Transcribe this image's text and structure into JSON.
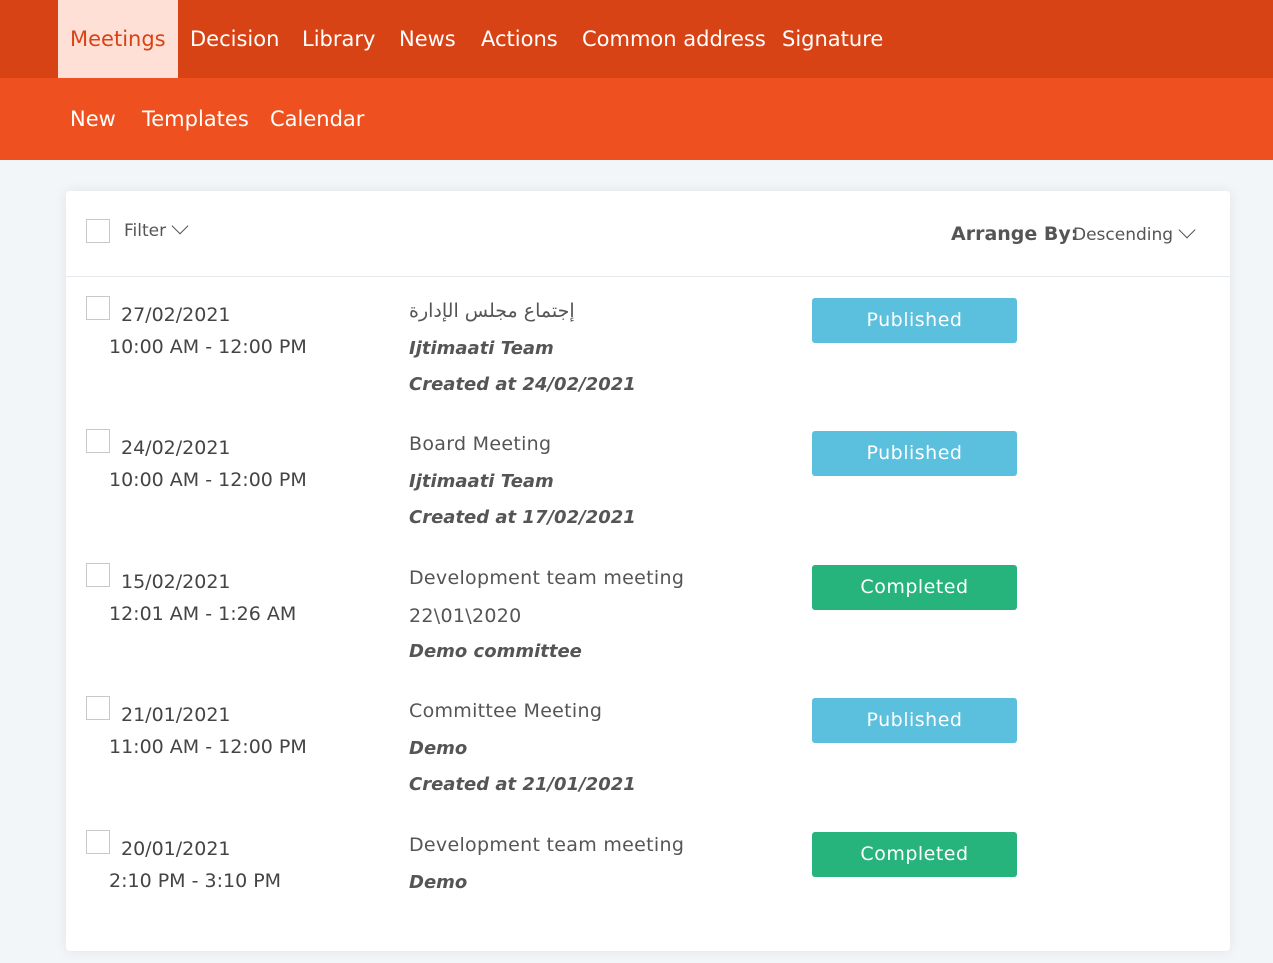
{
  "nav": {
    "items": [
      {
        "label": "Meetings",
        "active": true
      },
      {
        "label": "Decision"
      },
      {
        "label": "Library"
      },
      {
        "label": "News"
      },
      {
        "label": "Actions"
      },
      {
        "label": "Common address"
      },
      {
        "label": "Signature"
      }
    ]
  },
  "subnav": {
    "items": [
      {
        "label": "New"
      },
      {
        "label": "Templates"
      },
      {
        "label": "Calendar"
      }
    ]
  },
  "toolbar": {
    "filter_label": "Filter",
    "arrange_label": "Arrange By:",
    "arrange_value": "Descending"
  },
  "colors": {
    "published": "#5bc0de",
    "completed": "#26b47c",
    "nav_bg": "#d84315",
    "subnav_bg": "#ee511f"
  },
  "meetings": [
    {
      "date": "27/02/2021",
      "time": "10:00 AM - 12:00 PM",
      "title": "إجتماع مجلس الإدارة",
      "line2": "Ijtimaati Team",
      "line3": "Created at 24/02/2021",
      "status": "Published"
    },
    {
      "date": "24/02/2021",
      "time": "10:00 AM - 12:00 PM",
      "title": "Board Meeting",
      "line2": "Ijtimaati Team",
      "line3": "Created at 17/02/2021",
      "status": "Published"
    },
    {
      "date": "15/02/2021",
      "time": "12:01 AM - 1:26 AM",
      "title": "Development team meeting",
      "line2": "22\\01\\2020",
      "line3": "Demo committee",
      "status": "Completed"
    },
    {
      "date": "21/01/2021",
      "time": "11:00 AM - 12:00 PM",
      "title": "Committee Meeting",
      "line2": "Demo",
      "line3": "Created at 21/01/2021",
      "status": "Published"
    },
    {
      "date": "20/01/2021",
      "time": "2:10 PM - 3:10 PM",
      "title": "Development team meeting",
      "line2": "Demo",
      "line3": "",
      "status": "Completed"
    }
  ]
}
